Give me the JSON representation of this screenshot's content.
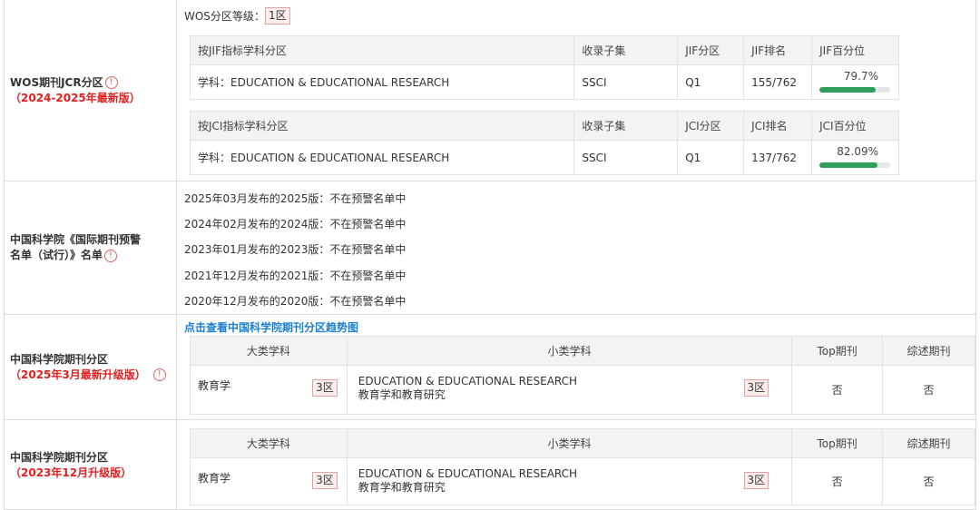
{
  "jcr": {
    "label_line1": "WOS期刊JCR分区",
    "label_line2": "（2024-2025年最新版）",
    "wos_level_label": "WOS分区等级：",
    "wos_level_value": "1区",
    "jif_table": {
      "headers": [
        "按JIF指标学科分区",
        "收录子集",
        "JIF分区",
        "JIF排名",
        "JIF百分位"
      ],
      "row": {
        "subject": "学科：EDUCATION & EDUCATIONAL RESEARCH",
        "subset": "SSCI",
        "quartile": "Q1",
        "rank": "155/762",
        "percentile": "79.7%"
      },
      "percentile_value": 79.7
    },
    "jci_table": {
      "headers": [
        "按JCI指标学科分区",
        "收录子集",
        "JCI分区",
        "JCI排名",
        "JCI百分位"
      ],
      "row": {
        "subject": "学科：EDUCATION & EDUCATIONAL RESEARCH",
        "subset": "SSCI",
        "quartile": "Q1",
        "rank": "137/762",
        "percentile": "82.09%"
      },
      "percentile_value": 82.09
    }
  },
  "warning": {
    "label_line1": "中国科学院《国际期刊预警",
    "label_line2": "名单（试行）》名单",
    "items": [
      "2025年03月发布的2025版：不在预警名单中",
      "2024年02月发布的2024版：不在预警名单中",
      "2023年01月发布的2023版：不在预警名单中",
      "2021年12月发布的2021版：不在预警名单中",
      "2020年12月发布的2020版：不在预警名单中"
    ]
  },
  "cas2025": {
    "label_line1": "中国科学院期刊分区",
    "label_line2": "（2025年3月最新升级版）",
    "trend_link": "点击查看中国科学院期刊分区趋势图",
    "headers": [
      "大类学科",
      "小类学科",
      "Top期刊",
      "综述期刊"
    ],
    "major": "教育学",
    "major_zone": "3区",
    "minor_en": "EDUCATION & EDUCATIONAL RESEARCH",
    "minor_cn": "教育学和教育研究",
    "minor_zone": "3区",
    "top": "否",
    "review": "否"
  },
  "cas2023": {
    "label_line1": "中国科学院期刊分区",
    "label_line2": "（2023年12月升级版）",
    "headers": [
      "大类学科",
      "小类学科",
      "Top期刊",
      "综述期刊"
    ],
    "major": "教育学",
    "major_zone": "3区",
    "minor_en": "EDUCATION & EDUCATIONAL RESEARCH",
    "minor_cn": "教育学和教育研究",
    "minor_zone": "3区",
    "top": "否",
    "review": "否"
  },
  "icon_names": [
    "info-icon"
  ]
}
